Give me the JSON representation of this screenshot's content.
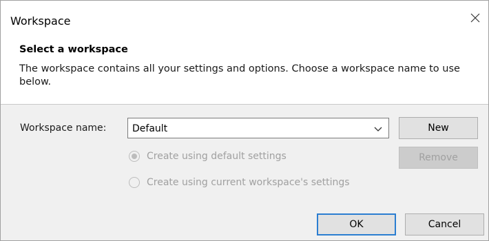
{
  "window": {
    "title": "Workspace",
    "close_icon": "close-icon"
  },
  "header": {
    "title": "Select a workspace",
    "description": "The workspace contains all your settings and options. Choose a workspace name to use below."
  },
  "workspace": {
    "label": "Workspace name:",
    "selected_value": "Default",
    "dropdown_icon": "chevron-down-icon"
  },
  "buttons": {
    "new": "New",
    "remove": "Remove",
    "ok": "OK",
    "cancel": "Cancel"
  },
  "options": [
    {
      "label": "Create using default settings",
      "selected": true,
      "enabled": false
    },
    {
      "label": "Create using current workspace's settings",
      "selected": false,
      "enabled": false
    }
  ],
  "colors": {
    "accent": "#2a7dd1",
    "disabled_text": "#a0a0a0"
  }
}
